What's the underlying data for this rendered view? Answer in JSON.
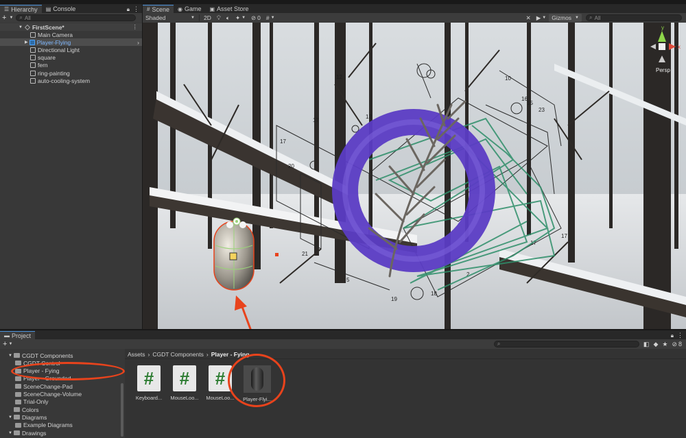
{
  "hierarchy": {
    "tab_label": "Hierarchy",
    "console_tab_label": "Console",
    "search_placeholder": "All",
    "scene_name": "FirstScene*",
    "items": [
      {
        "label": "Main Camera",
        "selected": false,
        "icon": "cube-icon"
      },
      {
        "label": "Player-Flying",
        "selected": true,
        "icon": "blue-cube-icon"
      },
      {
        "label": "Directional Light",
        "selected": false,
        "icon": "cube-icon"
      },
      {
        "label": "square",
        "selected": false,
        "icon": "cube-icon"
      },
      {
        "label": "fern",
        "selected": false,
        "icon": "cube-icon"
      },
      {
        "label": "ring-painting",
        "selected": false,
        "icon": "cube-icon"
      },
      {
        "label": "auto-cooling-system",
        "selected": false,
        "icon": "cube-icon"
      }
    ]
  },
  "scene_tabs": {
    "scene": "Scene",
    "game": "Game",
    "asset_store": "Asset Store"
  },
  "scene_toolbar": {
    "shading_mode": "Shaded",
    "mode_2d": "2D",
    "hidden_count": "0",
    "gizmos_label": "Gizmos",
    "search_placeholder": "All"
  },
  "gizmo": {
    "persp_label": "Persp",
    "axis_x": "x",
    "axis_y": "y"
  },
  "project": {
    "tab_label": "Project",
    "hidden_count": "8",
    "breadcrumb": [
      "Assets",
      "CGDT Components",
      "Player - Fying"
    ],
    "folders": [
      {
        "label": "CGDT Components",
        "depth": 1,
        "expanded": true
      },
      {
        "label": "CGDT Control",
        "depth": 2,
        "expanded": false
      },
      {
        "label": "Player - Fying",
        "depth": 2,
        "expanded": false,
        "selected": true
      },
      {
        "label": "Player - Grounded",
        "depth": 2,
        "expanded": false
      },
      {
        "label": "SceneChange-Pad",
        "depth": 2,
        "expanded": false
      },
      {
        "label": "SceneChange-Volume",
        "depth": 2,
        "expanded": false
      },
      {
        "label": "Trial-Only",
        "depth": 2,
        "expanded": false
      },
      {
        "label": "Colors",
        "depth": 1,
        "expanded": false
      },
      {
        "label": "Diagrams",
        "depth": 1,
        "expanded": true
      },
      {
        "label": "Example Diagrams",
        "depth": 2,
        "expanded": false
      },
      {
        "label": "Drawings",
        "depth": 1,
        "expanded": true
      }
    ],
    "assets": [
      {
        "label": "Keyboard...",
        "type": "script"
      },
      {
        "label": "MouseLoo...",
        "type": "script"
      },
      {
        "label": "MouseLoo...",
        "type": "script"
      },
      {
        "label": "Player-Flyi...",
        "type": "prefab"
      }
    ]
  },
  "diagram_numbers": [
    "17",
    "12",
    "17",
    "12",
    "20",
    "21",
    "5",
    "19",
    "18",
    "2",
    "17",
    "17",
    "10",
    "16",
    "23",
    "15"
  ],
  "colors": {
    "accent": "#4a90d9",
    "annotation": "#e8431c",
    "ring": "#5b3cc4",
    "scribble": "#2f8f6a"
  }
}
